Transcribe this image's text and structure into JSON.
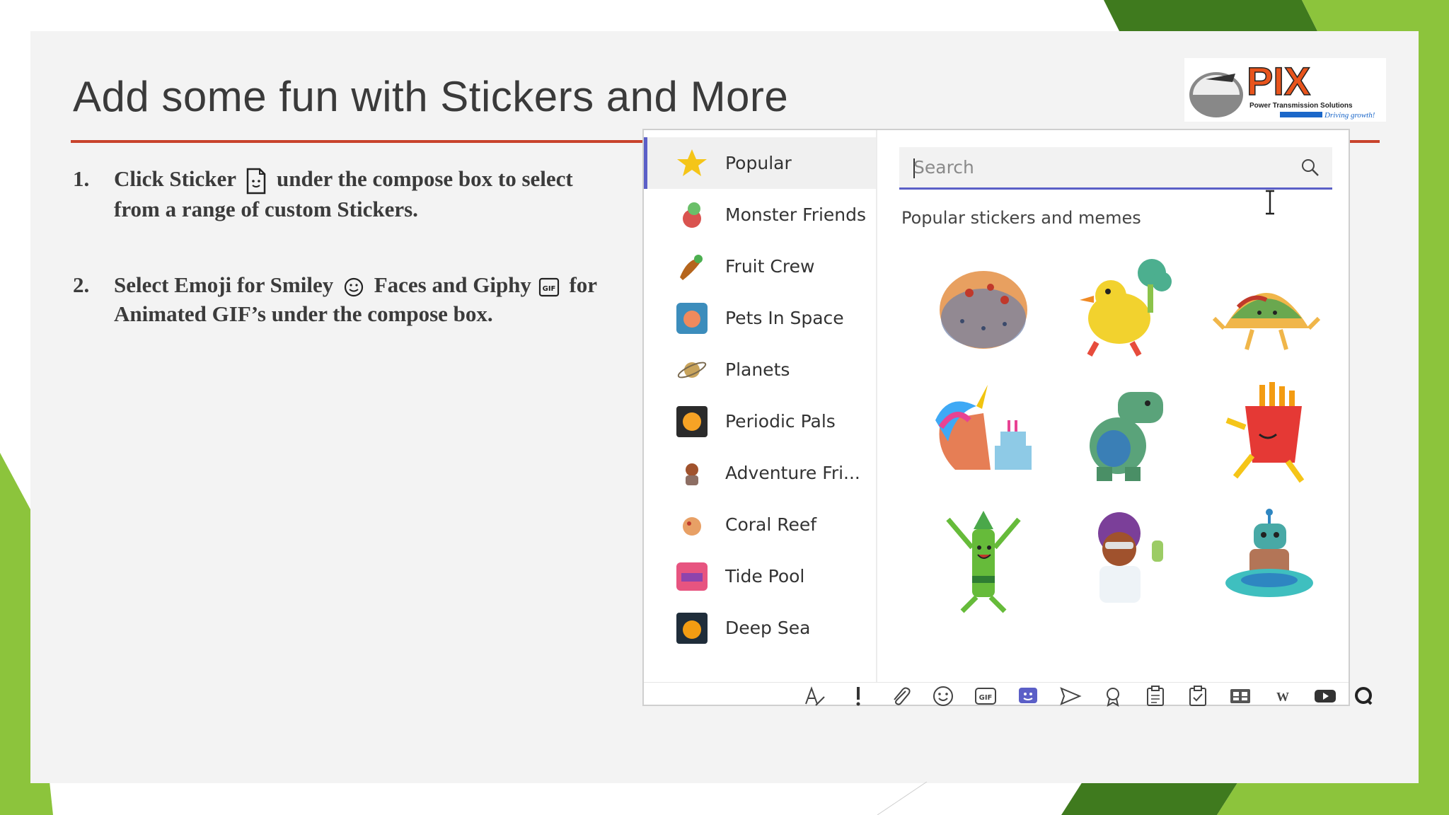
{
  "slide": {
    "title": "Add some fun with Stickers and More",
    "logo": {
      "name": "PIX",
      "subtitle": "Power Transmission Solutions",
      "tagline": "Driving growth!"
    },
    "steps": [
      {
        "number": "1.",
        "text_before": "Click Sticker",
        "text_after": "under the compose box to select from a range of custom Stickers.",
        "icon": "sticker-icon"
      },
      {
        "number": "2.",
        "text_before": "Select Emoji for Smiley",
        "text_middle": "Faces and Giphy",
        "text_after": "for Animated GIF’s under the compose box.",
        "icons": [
          "smiley-icon",
          "gif-icon"
        ]
      }
    ]
  },
  "sticker_panel": {
    "categories": [
      {
        "label": "Popular",
        "icon": "star-icon",
        "active": true
      },
      {
        "label": "Monster Friends",
        "icon": "monster-icon"
      },
      {
        "label": "Fruit Crew",
        "icon": "fruit-icon"
      },
      {
        "label": "Pets In Space",
        "icon": "pets-icon"
      },
      {
        "label": "Planets",
        "icon": "planet-icon"
      },
      {
        "label": "Periodic Pals",
        "icon": "periodic-icon"
      },
      {
        "label": "Adventure Fri...",
        "icon": "adventure-icon"
      },
      {
        "label": "Coral Reef",
        "icon": "coral-icon"
      },
      {
        "label": "Tide Pool",
        "icon": "tidepool-icon"
      },
      {
        "label": "Deep Sea",
        "icon": "deepsea-icon"
      }
    ],
    "search": {
      "placeholder": "Search"
    },
    "section_title": "Popular stickers and memes",
    "stickers": [
      "coral-blob-sticker",
      "duck-with-broccoli-sticker",
      "taco-sticker",
      "unicorn-cake-sticker",
      "dinosaur-sticker",
      "fries-sticker",
      "crayon-sticker",
      "scientist-sticker",
      "robot-ufo-sticker"
    ],
    "toolbar": [
      "format-icon",
      "important-icon",
      "attach-icon",
      "emoji-icon",
      "gif-icon",
      "sticker-icon",
      "send-icon",
      "praise-icon",
      "forms-icon",
      "approvals-icon",
      "tasks-icon",
      "wiki-icon",
      "youtube-icon",
      "quiz-icon"
    ]
  },
  "colors": {
    "accent": "#5b5fc7",
    "title_rule": "#c8432c",
    "green_dark": "#3f7a1e",
    "green_light": "#8cc43c"
  }
}
